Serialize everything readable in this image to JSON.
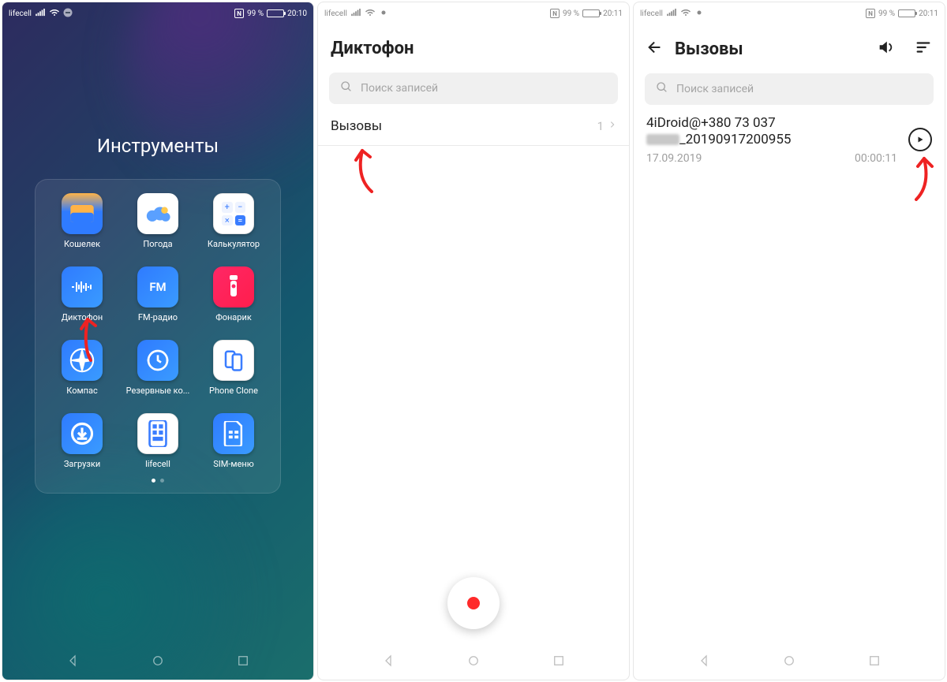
{
  "status": {
    "carrier": "lifecell",
    "nfc_label": "N",
    "battery_text": "99 %",
    "battery_level": 0.99,
    "time_s1": "20:10",
    "time_s2": "20:11",
    "time_s3": "20:11"
  },
  "screen1": {
    "folder_title": "Инструменты",
    "apps": [
      {
        "label": "Кошелек",
        "icon": "wallet"
      },
      {
        "label": "Погода",
        "icon": "weather"
      },
      {
        "label": "Калькулятор",
        "icon": "calc"
      },
      {
        "label": "Диктофон",
        "icon": "recorder"
      },
      {
        "label": "FM-радио",
        "icon": "fm",
        "icon_text": "FM"
      },
      {
        "label": "Фонарик",
        "icon": "torch"
      },
      {
        "label": "Компас",
        "icon": "compass"
      },
      {
        "label": "Резервные ко...",
        "icon": "backup"
      },
      {
        "label": "Phone Clone",
        "icon": "clone"
      },
      {
        "label": "Загрузки",
        "icon": "dl"
      },
      {
        "label": "lifecell",
        "icon": "lifecell"
      },
      {
        "label": "SIM-меню",
        "icon": "sim"
      }
    ]
  },
  "screen2": {
    "title": "Диктофон",
    "search_placeholder": "Поиск записей",
    "row_label": "Вызовы",
    "row_count": "1"
  },
  "screen3": {
    "title": "Вызовы",
    "search_placeholder": "Поиск записей",
    "recording": {
      "line1": "4iDroid@+380 73 037",
      "line2_suffix": "_20190917200955",
      "date": "17.09.2019",
      "duration": "00:00:11"
    }
  }
}
